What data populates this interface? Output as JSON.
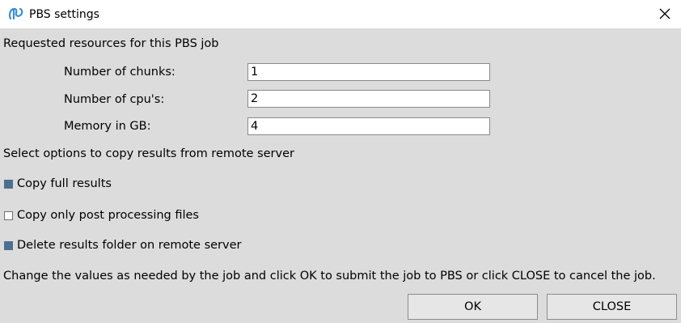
{
  "window": {
    "title": "PBS settings",
    "app_icon": "pbs-logo-icon",
    "close_icon": "close-icon"
  },
  "resources": {
    "heading": "Requested resources for this PBS job",
    "chunks_label": "Number of chunks:",
    "chunks_value": "1",
    "cpus_label": "Number of cpu's:",
    "cpus_value": "2",
    "memory_label": "Memory in GB:",
    "memory_value": "4"
  },
  "copy_options": {
    "heading": "Select options to copy results from remote server",
    "copy_full_label": "Copy full results",
    "copy_full_checked": true,
    "copy_post_label": "Copy only post processing files",
    "copy_post_checked": false,
    "delete_label": "Delete results folder on remote server",
    "delete_checked": true
  },
  "footer": {
    "instruction": "Change the values as needed by the job and  click OK to submit the job to PBS or click CLOSE to cancel the job.",
    "ok_label": "OK",
    "close_label": "CLOSE"
  },
  "colors": {
    "dialog_background": "#dcdcdc",
    "checkbox_checked": "#4d6f90",
    "icon_blue": "#3a8ed6"
  }
}
